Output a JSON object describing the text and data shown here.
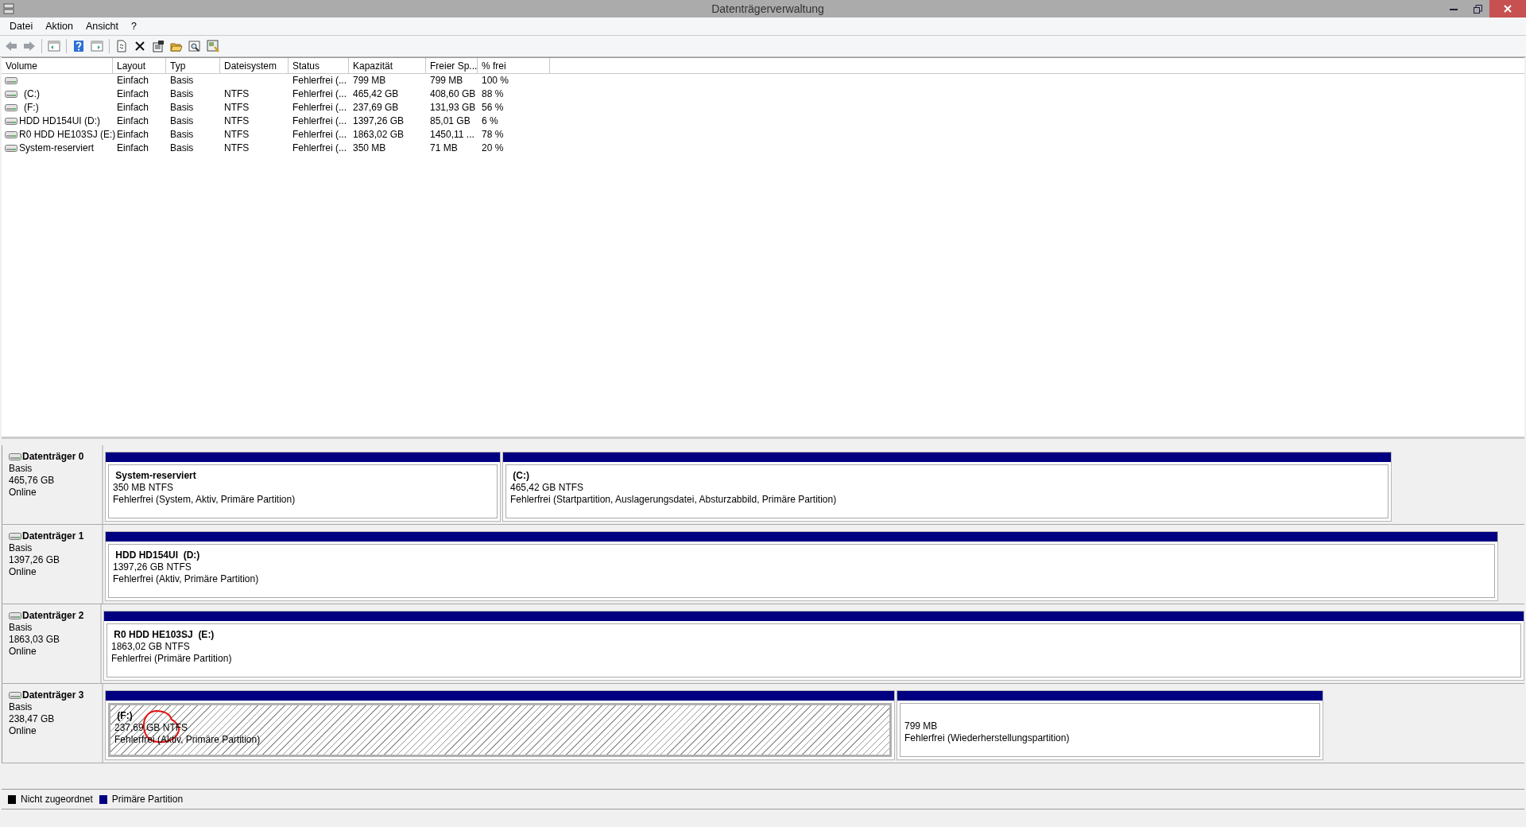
{
  "window": {
    "title": "Datenträgerverwaltung"
  },
  "menu": [
    "Datei",
    "Aktion",
    "Ansicht",
    "?"
  ],
  "volume_table": {
    "columns": [
      "Volume",
      "Layout",
      "Typ",
      "Dateisystem",
      "Status",
      "Kapazität",
      "Freier Sp...",
      "% frei"
    ],
    "rows": [
      [
        null,
        "Einfach",
        "Basis",
        null,
        "Fehlerfrei (...",
        "799 MB",
        "799 MB",
        "100 %"
      ],
      [
        "(C:)",
        "Einfach",
        "Basis",
        "NTFS",
        "Fehlerfrei (...",
        "465,42 GB",
        "408,60 GB",
        "88 %"
      ],
      [
        "(F:)",
        "Einfach",
        "Basis",
        "NTFS",
        "Fehlerfrei (...",
        "237,69 GB",
        "131,93 GB",
        "56 %"
      ],
      [
        "HDD HD154UI (D:)",
        "Einfach",
        "Basis",
        "NTFS",
        "Fehlerfrei (...",
        "1397,26 GB",
        "85,01 GB",
        "6 %"
      ],
      [
        "R0 HDD HE103SJ (E:)",
        "Einfach",
        "Basis",
        "NTFS",
        "Fehlerfrei (...",
        "1863,02 GB",
        "1450,11 ...",
        "78 %"
      ],
      [
        "System-reserviert",
        "Einfach",
        "Basis",
        "NTFS",
        "Fehlerfrei (...",
        "350 MB",
        "71 MB",
        "20 %"
      ]
    ]
  },
  "disks": [
    {
      "name": "Datenträger 0",
      "type": "Basis",
      "size": "465,76 GB",
      "status": "Online",
      "partitions": [
        {
          "label": "System-reserviert",
          "size": "350 MB NTFS",
          "status": "Fehlerfrei (System, Aktiv, Primäre Partition)",
          "selected": false
        },
        {
          "label": "(C:)",
          "size": "465,42 GB NTFS",
          "status": "Fehlerfrei (Startpartition, Auslagerungsdatei, Absturzabbild, Primäre Partition)",
          "selected": false
        }
      ]
    },
    {
      "name": "Datenträger 1",
      "type": "Basis",
      "size": "1397,26 GB",
      "status": "Online",
      "partitions": [
        {
          "label": "HDD HD154UI  (D:)",
          "size": "1397,26 GB NTFS",
          "status": "Fehlerfrei (Aktiv, Primäre Partition)",
          "selected": false
        }
      ]
    },
    {
      "name": "Datenträger 2",
      "type": "Basis",
      "size": "1863,03 GB",
      "status": "Online",
      "partitions": [
        {
          "label": "R0 HDD HE103SJ  (E:)",
          "size": "1863,02 GB NTFS",
          "status": "Fehlerfrei (Primäre Partition)",
          "selected": false
        }
      ]
    },
    {
      "name": "Datenträger 3",
      "type": "Basis",
      "size": "238,47 GB",
      "status": "Online",
      "partitions": [
        {
          "label": "(F:)",
          "size": "237,69 GB NTFS",
          "status": "Fehlerfrei (Aktiv, Primäre Partition)",
          "selected": true
        },
        {
          "size": "799 MB",
          "status": "Fehlerfrei (Wiederherstellungspartition)",
          "selected": false
        }
      ]
    }
  ],
  "legend": [
    {
      "label": "Nicht zugeordnet",
      "color": "#000000"
    },
    {
      "label": "Primäre Partition",
      "color": "#000080"
    }
  ]
}
